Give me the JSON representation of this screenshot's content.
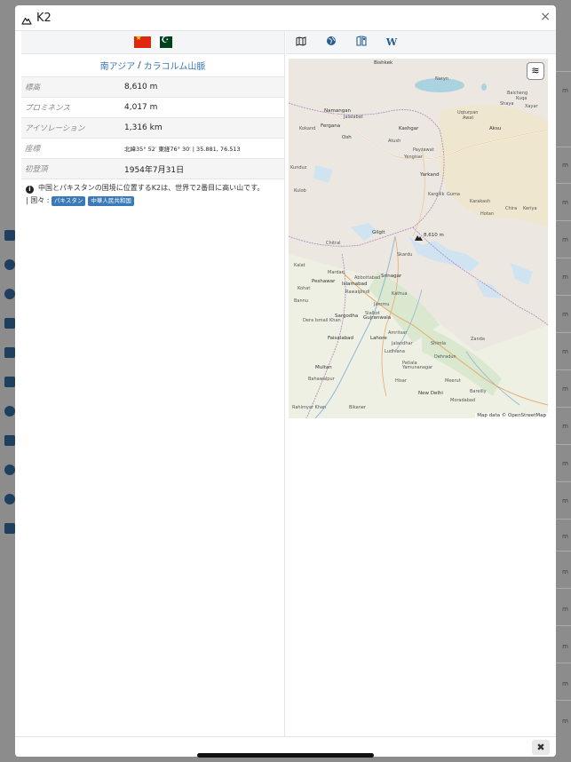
{
  "window": {
    "title": "K2"
  },
  "flags": [
    {
      "country": "China",
      "icon": "flag-china"
    },
    {
      "country": "Pakistan",
      "icon": "flag-pakistan"
    }
  ],
  "breadcrumb": {
    "region": "南アジア",
    "separator": "/",
    "range": "カラコルム山脈"
  },
  "info_rows": [
    {
      "label": "標高",
      "value": "8,610 m"
    },
    {
      "label": "プロミネンス",
      "value": "4,017 m"
    },
    {
      "label": "アイソレーション",
      "value": "1,316 km"
    },
    {
      "label": "座標",
      "value": "北緯35° 52′ 東経76° 30′ | 35.881, 76.513"
    },
    {
      "label": "初登頂",
      "value": "1954年7月31日"
    }
  ],
  "description": {
    "text": "中国とパキスタンの国境に位置するK2は、世界で2番目に高い山です。",
    "countries_label": "| 国々 :",
    "countries": [
      "パキスタン",
      "中華人民共和国"
    ]
  },
  "map_tabs": [
    {
      "name": "map-icon"
    },
    {
      "name": "globe-icon"
    },
    {
      "name": "book-map-icon"
    },
    {
      "name": "wikipedia-icon",
      "text": "W"
    }
  ],
  "map": {
    "attribution": "Map data © OpenStreetMap",
    "peak_label": "8,610 m",
    "places": [
      "Bishkek",
      "Naryn",
      "Namangan",
      "Jalalabat",
      "Fergana",
      "Osh",
      "Kokand",
      "Kashgar",
      "Atush",
      "Aksu",
      "Baicheng",
      "Kuqa",
      "Shaya",
      "Xayar",
      "Awat",
      "Uqturpan",
      "Yengisar",
      "Payzawat",
      "Yarkand",
      "Kargilik",
      "Guma",
      "Karakash",
      "Chira",
      "Keriya",
      "Hotan",
      "Gilgit",
      "Skardu",
      "Peshawar",
      "Mardan",
      "Islamabad",
      "Rawalpindi",
      "Srinagar",
      "Jammu",
      "Sialkot",
      "Gujranwala",
      "Lahore",
      "Faisalabad",
      "Sargodha",
      "Multan",
      "Bahawalpur",
      "Amritsar",
      "Jalandhar",
      "Ludhiana",
      "Patiala",
      "Dehradun",
      "Meerut",
      "New Delhi",
      "Moradabad",
      "Bareilly",
      "Bikaner",
      "Rahimyar Khan",
      "Dera Ismail Khan",
      "Bannu",
      "Kohat",
      "Kunduz",
      "Kulob",
      "Chitral",
      "Abbottabad",
      "Kalat",
      "Zanda",
      "Shimla",
      "Yamunanagar",
      "Hisar",
      "Kathua"
    ]
  },
  "footer": {
    "close_label": "✖"
  },
  "background": {
    "sidebar_icons": [
      "list-icon",
      "plus-circle-icon",
      "globe-icon",
      "box-icon",
      "star-icon",
      "table-icon",
      "compass-icon",
      "camera-icon",
      "info-icon",
      "gear-icon",
      "grid-icon"
    ],
    "right_snippets": [
      "m",
      "m",
      "m",
      "m",
      "m",
      "m",
      "m",
      "m",
      "m",
      "m",
      "m",
      "m",
      "m",
      "m",
      "m",
      "m",
      "m"
    ]
  }
}
